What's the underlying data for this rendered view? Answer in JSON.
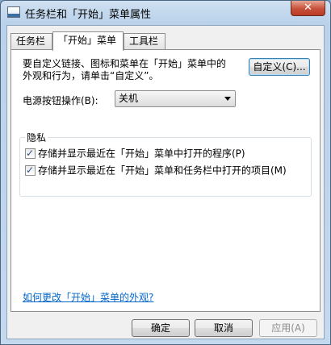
{
  "window": {
    "title": "任务栏和「开始」菜单属性",
    "close_label": "✕"
  },
  "tabs": [
    {
      "label": "任务栏",
      "active": false
    },
    {
      "label": "「开始」菜单",
      "active": true
    },
    {
      "label": "工具栏",
      "active": false
    }
  ],
  "panel": {
    "description_line1": "要自定义链接、图标和菜单在「开始」菜单中的",
    "description_line2": "外观和行为，请单击“自定义”。",
    "customize_button": "自定义(C)...",
    "power_label": "电源按钮操作(B):",
    "power_value": "关机",
    "privacy": {
      "title": "隐私",
      "options": [
        {
          "label": "存储并显示最近在「开始」菜单中打开的程序(P)",
          "checked": true
        },
        {
          "label": "存储并显示最近在「开始」菜单和任务栏中打开的项目(M)",
          "checked": true
        }
      ]
    },
    "help_link": "如何更改「开始」菜单的外观?"
  },
  "footer": {
    "ok": "确定",
    "cancel": "取消",
    "apply": "应用(A)"
  }
}
